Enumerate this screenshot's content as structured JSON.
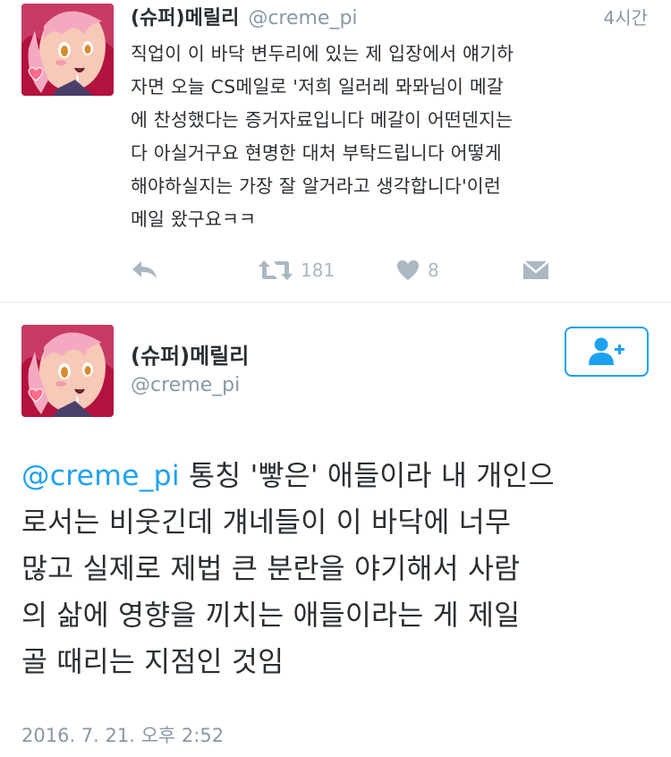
{
  "tweet1": {
    "display_name": "(슈퍼)메릴리",
    "handle": "@creme_pi",
    "time": "4시간",
    "text_lines": [
      "직업이 이 바닥 변두리에 있는 제 입장에서 얘기하",
      "자면 오늘 CS메일로 '저희 일러레 뫄뫄님이 메갈",
      "에 찬성했다는 증거자료입니다 메갈이 어떤덴지는",
      "다 아실거구요 현명한 대처 부탁드립니다 어떻게",
      "해야하실지는 가장 잘 알거라고 생각합니다'이런",
      "메일 왔구요ㅋㅋ"
    ],
    "actions": {
      "reply_icon": "reply-icon",
      "retweet_icon": "retweet-icon",
      "retweet_count": "181",
      "like_icon": "heart-icon",
      "like_count": "8",
      "dm_icon": "envelope-icon"
    }
  },
  "tweet2": {
    "display_name": "(슈퍼)메릴리",
    "handle": "@creme_pi",
    "follow_icon": "add-user-icon",
    "mention": "@creme_pi",
    "text_lines": [
      " 통칭 '빻은' 애들이라 내 개인으",
      "로서는 비웃긴데 걔네들이 이 바닥에 너무",
      "많고 실제로 제법 큰 분란을 야기해서 사람",
      "의 삶에 영향을 끼치는 애들이라는 게 제일",
      "골 때리는 지점인 것임"
    ],
    "date": "2016. 7. 21. 오후 2:52"
  },
  "colors": {
    "link": "#1da1f2",
    "secondary_text": "#8899a6",
    "icon_gray": "#aab8c2",
    "primary_text": "#292f33"
  }
}
